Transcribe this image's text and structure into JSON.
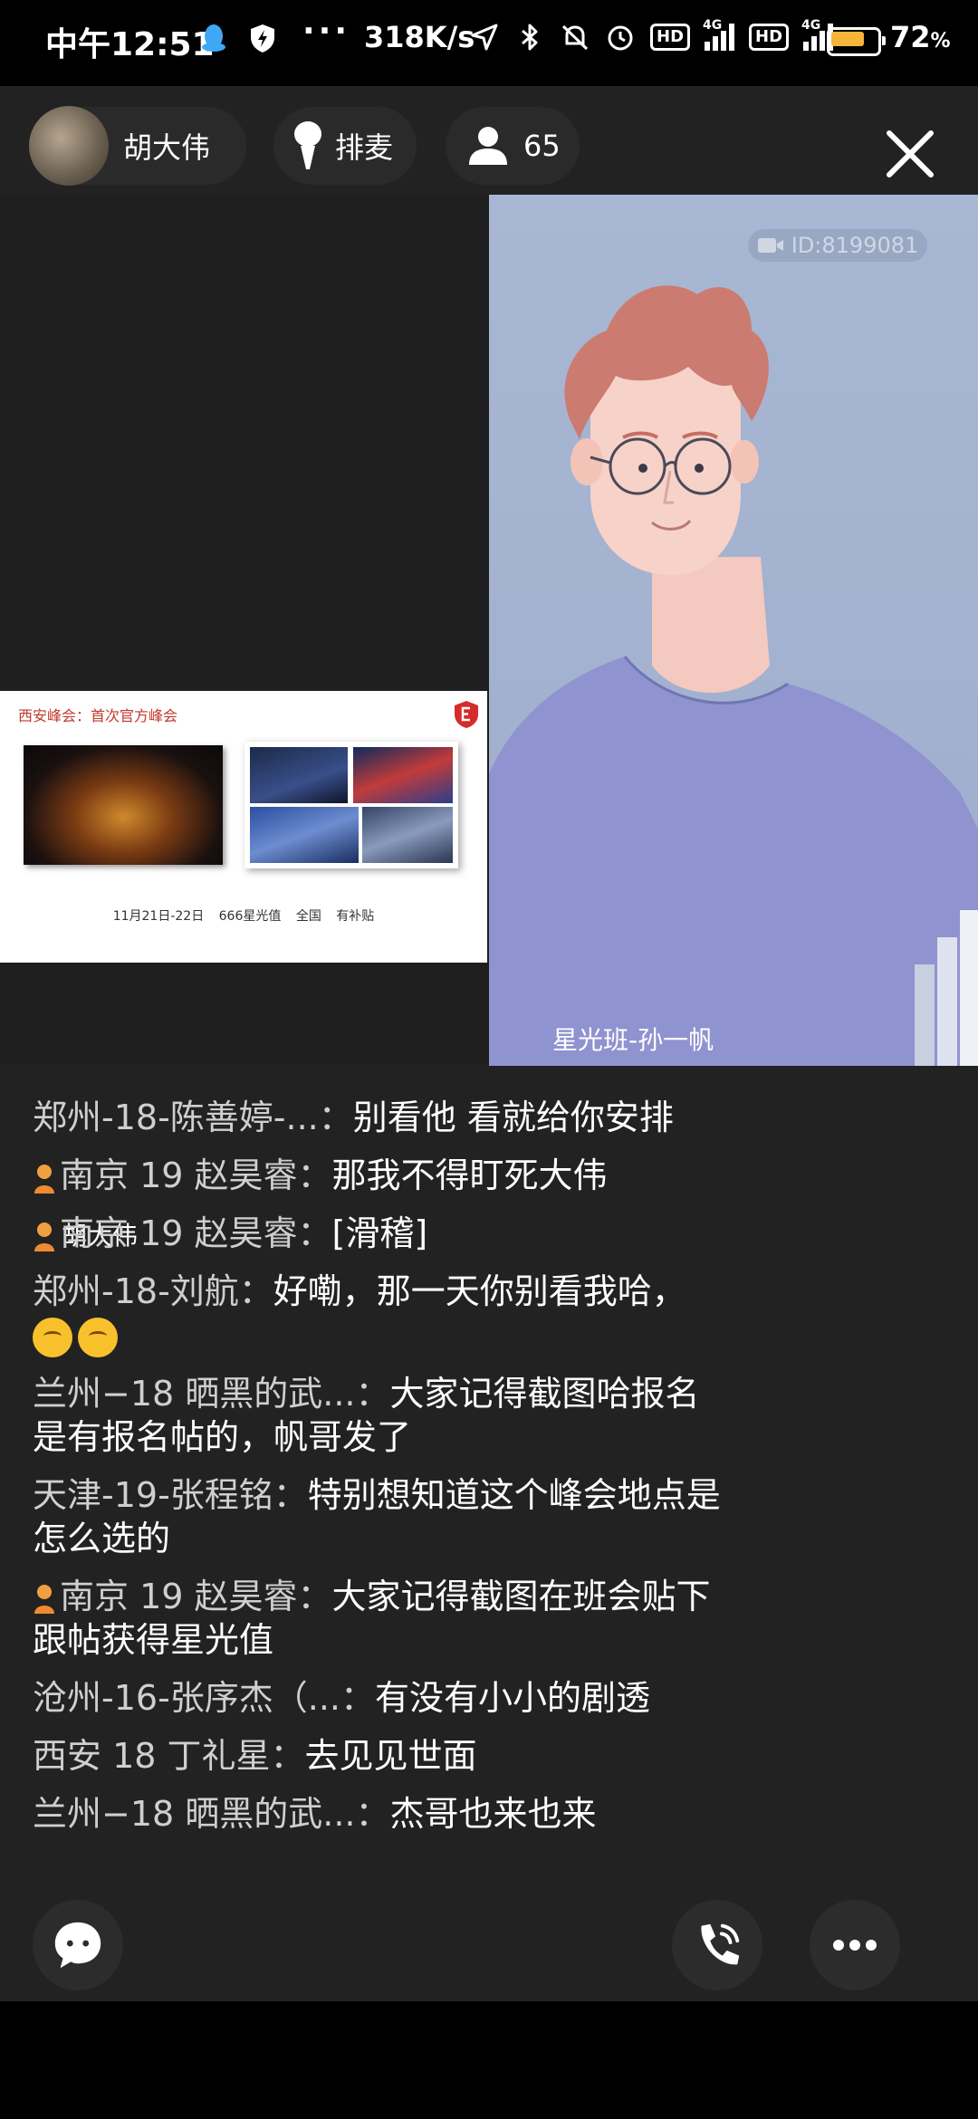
{
  "status_bar": {
    "time": "中午12:51",
    "dots": "···",
    "net_speed": "318K/s",
    "hd1": "HD",
    "hd2": "HD",
    "net_tag1": "4G",
    "net_tag2": "4G",
    "battery_level": 0.72,
    "battery_pct": "72",
    "battery_unit": "%"
  },
  "header": {
    "host_name": "胡大伟",
    "mic_queue_label": "排麦",
    "viewer_count": "65"
  },
  "stream_left": {
    "speaker_label": "胡大伟",
    "slide_title": "西安峰会：首次官方峰会",
    "slide_caption": "11月21日-22日  666星光值  全国  有补贴"
  },
  "stream_right": {
    "id_badge": "ID:8199081",
    "speaker_label": "星光班-孙一帆"
  },
  "chat": [
    {
      "name": "郑州-18-陈善婷-...：",
      "text": "别看他 看就给你安排",
      "avatar": false
    },
    {
      "name": "南京 19 赵昊睿：",
      "text": "那我不得盯死大伟",
      "avatar": true
    },
    {
      "name": "南京 19 赵昊睿：",
      "text": "[滑稽]",
      "avatar": true
    },
    {
      "name": "郑州-18-刘航：",
      "text": "好嘞，那一天你别看我哈，",
      "avatar": false,
      "emoji_count": 2
    },
    {
      "name": "兰州−18 晒黑的武...：",
      "text": "大家记得截图哈报名是有报名帖的，帆哥发了",
      "avatar": false
    },
    {
      "name": "天津-19-张程铭：",
      "text": "特别想知道这个峰会地点是怎么选的",
      "avatar": false
    },
    {
      "name": "南京 19 赵昊睿：",
      "text": "大家记得截图在班会贴下跟帖获得星光值",
      "avatar": true
    },
    {
      "name": "沧州-16-张序杰（...：",
      "text": "有没有小小的剧透",
      "avatar": false
    },
    {
      "name": "西安 18 丁礼星：",
      "text": "去见见世面",
      "avatar": false
    },
    {
      "name": "兰州−18 晒黑的武...：",
      "text": "杰哥也来也来",
      "avatar": false
    }
  ],
  "colors": {
    "background": "#222222",
    "battery_fill": "#f5b43a",
    "avatar_panel_bg": "#a8b7d3"
  }
}
